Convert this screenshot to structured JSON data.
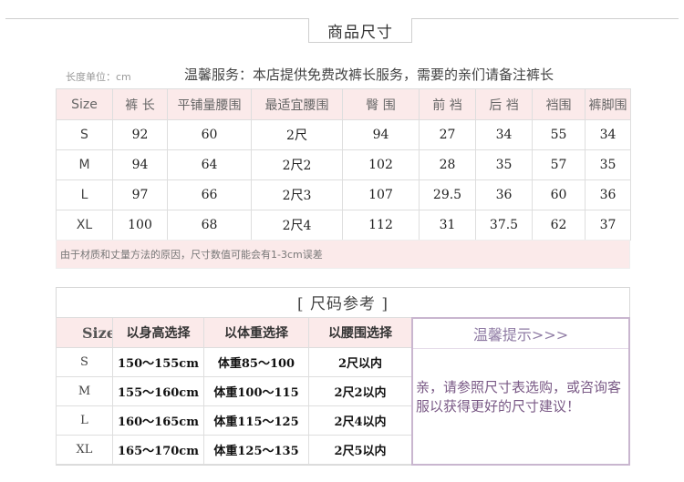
{
  "header": {
    "title": "商品尺寸"
  },
  "unit_note": "长度单位：cm",
  "service_note": "温馨服务：本店提供免费改裤长服务，需要的亲们请备注裤长",
  "size_table": {
    "columns": [
      "Size",
      "裤 长",
      "平铺量腰围",
      "最适宜腰围",
      "臀 围",
      "前 裆",
      "后 裆",
      "裆围",
      "裤脚围"
    ],
    "rows": [
      [
        "S",
        "92",
        "60",
        "2尺",
        "94",
        "27",
        "34",
        "55",
        "34"
      ],
      [
        "M",
        "94",
        "64",
        "2尺2",
        "102",
        "28",
        "35",
        "57",
        "35"
      ],
      [
        "L",
        "97",
        "66",
        "2尺3",
        "107",
        "29.5",
        "36",
        "60",
        "36"
      ],
      [
        "XL",
        "100",
        "68",
        "2尺4",
        "112",
        "31",
        "37.5",
        "62",
        "37"
      ]
    ]
  },
  "footnote": "由于材质和丈量方法的原因，尺寸数值可能会有1-3cm误差",
  "ref_title": "[ 尺码参考 ]",
  "ref_table": {
    "columns": [
      "Size",
      "以身高选择",
      "以体重选择",
      "以腰围选择"
    ],
    "rows": [
      [
        "S",
        "150～155cm",
        "体重85～100",
        "2尺以内"
      ],
      [
        "M",
        "155～160cm",
        "体重100～115",
        "2尺2以内"
      ],
      [
        "L",
        "160～165cm",
        "体重115～125",
        "2尺4以内"
      ],
      [
        "XL",
        "165～170cm",
        "体重125～135",
        "2尺5以内"
      ]
    ]
  },
  "tips": {
    "title": "温馨提示>>>",
    "body": "亲，请参照尺寸表选购，或咨询客服以获得更好的尺寸建议！"
  }
}
